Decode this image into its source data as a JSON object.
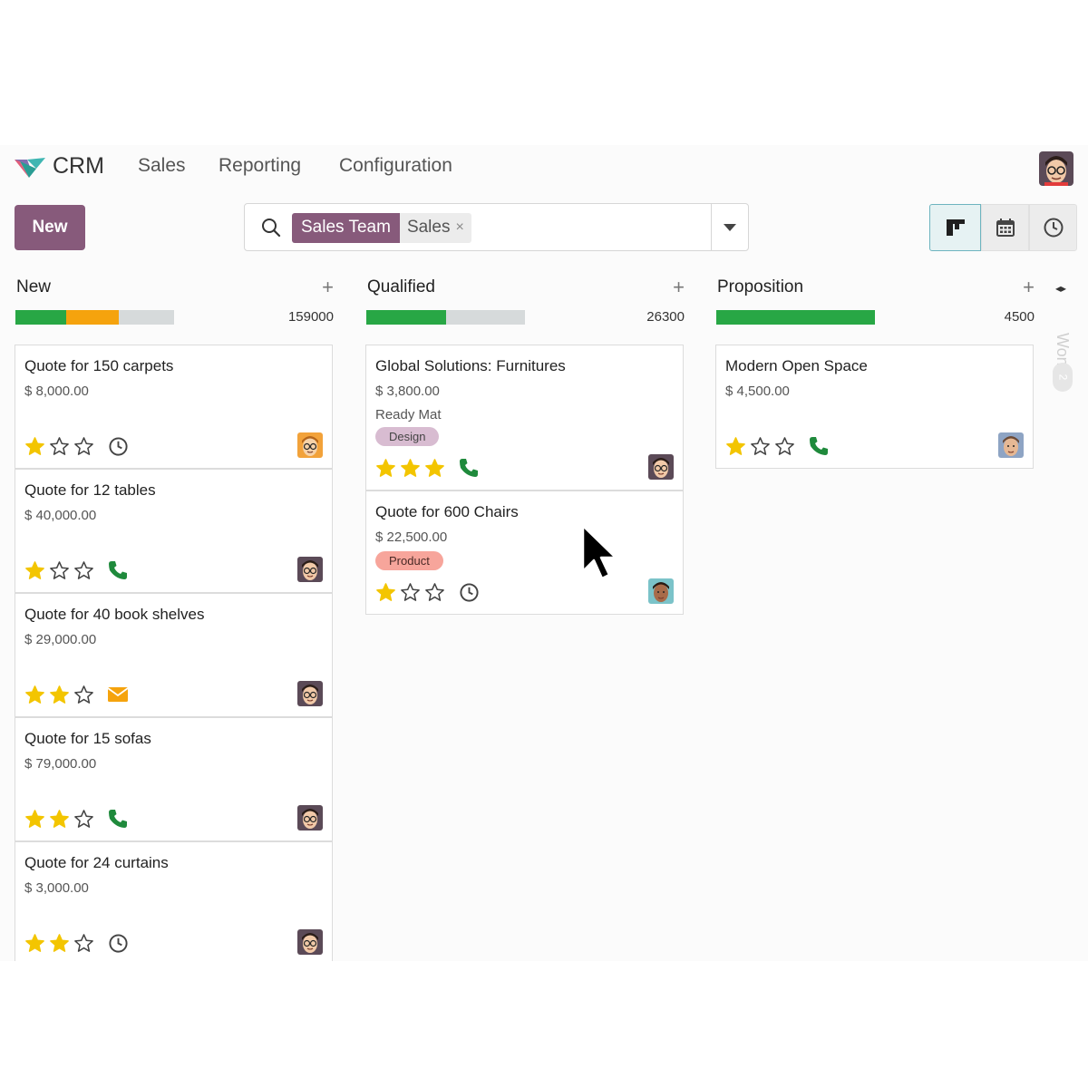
{
  "nav": {
    "app_name": "CRM",
    "menu": [
      "Sales",
      "Reporting",
      "Configuration"
    ]
  },
  "toolbar": {
    "new_label": "New"
  },
  "search": {
    "facet_label": "Sales Team",
    "facet_value": "Sales",
    "facet_remove": "×",
    "placeholder": ""
  },
  "colors": {
    "primary": "#875a7b",
    "green": "#28a745",
    "orange": "#f5a30d",
    "star": "#f3c500",
    "phone": "#1f8a3c"
  },
  "columns": [
    {
      "title": "New",
      "add_label": "+",
      "total": "159000",
      "progress": {
        "green": 0.32,
        "orange": 0.33
      },
      "cards": [
        {
          "title": "Quote for 150 carpets",
          "amount": "$ 8,000.00",
          "stars": 1,
          "activity": "clock-icon",
          "avatar": "avatar-orange"
        },
        {
          "title": "Quote for 12 tables",
          "amount": "$ 40,000.00",
          "stars": 1,
          "activity": "phone-icon",
          "avatar": "avatar-man"
        },
        {
          "title": "Quote for 40 book shelves",
          "amount": "$ 29,000.00",
          "stars": 2,
          "activity": "envelope-icon",
          "avatar": "avatar-man"
        },
        {
          "title": "Quote for 15 sofas",
          "amount": "$ 79,000.00",
          "stars": 2,
          "activity": "phone-icon",
          "avatar": "avatar-man"
        },
        {
          "title": "Quote for 24 curtains",
          "amount": "$ 3,000.00",
          "stars": 2,
          "activity": "clock-icon",
          "avatar": "avatar-man"
        }
      ]
    },
    {
      "title": "Qualified",
      "add_label": "+",
      "total": "26300",
      "progress": {
        "green": 0.5,
        "orange": 0
      },
      "cards": [
        {
          "title": "Global Solutions: Furnitures",
          "amount": "$ 3,800.00",
          "company": "Ready Mat",
          "tag": "Design",
          "stars": 3,
          "activity": "phone-icon",
          "avatar": "avatar-man"
        },
        {
          "title": "Quote for 600 Chairs",
          "amount": "$ 22,500.00",
          "tag": "Product",
          "stars": 1,
          "activity": "clock-icon",
          "avatar": "avatar-teal"
        }
      ]
    },
    {
      "title": "Proposition",
      "add_label": "+",
      "total": "4500",
      "progress": {
        "green": 1.0,
        "orange": 0
      },
      "cards": [
        {
          "title": "Modern Open Space",
          "amount": "$ 4,500.00",
          "stars": 1,
          "activity": "phone-icon",
          "avatar": "avatar-blue"
        }
      ]
    }
  ],
  "folded_column": {
    "title": "Won",
    "count": "2"
  }
}
